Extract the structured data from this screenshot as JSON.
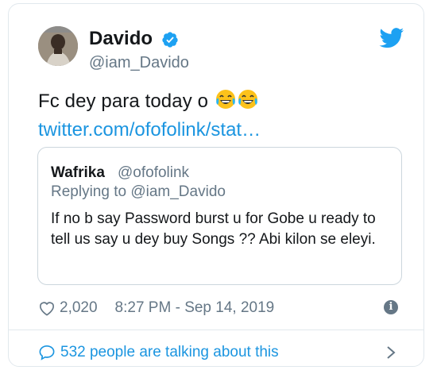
{
  "author": {
    "name": "Davido",
    "handle": "@iam_Davido",
    "verified": true
  },
  "tweet": {
    "text": "Fc dey para today o",
    "emojis": [
      "face-with-tears-of-joy",
      "face-with-tears-of-joy"
    ],
    "link": "twitter.com/ofofolink/stat…"
  },
  "quoted": {
    "name": "Wafrika",
    "handle": "@ofofolink",
    "replying": "Replying to @iam_Davido",
    "body": "If no b say Password burst u for Gobe u ready to tell us say u dey buy Songs ?? Abi kilon se eleyi."
  },
  "meta": {
    "likes": "2,020",
    "timestamp": "8:27 PM - Sep 14, 2019"
  },
  "footer": {
    "talking": "532 people are talking about this"
  },
  "colors": {
    "accent": "#1b95e0",
    "muted": "#657786",
    "border": "#e1e8ed"
  },
  "icons": [
    "avatar",
    "verified-badge-icon",
    "twitter-bird-icon",
    "heart-icon",
    "info-icon",
    "comment-bubble-icon",
    "chevron-right-icon"
  ]
}
